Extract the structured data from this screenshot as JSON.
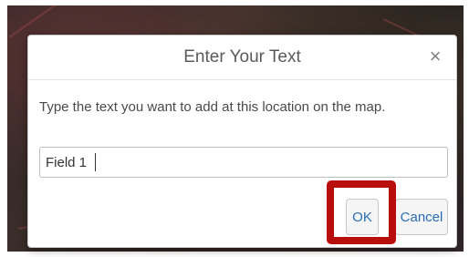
{
  "dialog": {
    "title": "Enter Your Text",
    "close_icon": "close-icon",
    "close_glyph": "×",
    "message": "Type the text you want to add at this location on the map.",
    "input_value": "Field 1",
    "ok_label": "OK",
    "cancel_label": "Cancel"
  },
  "annotation": {
    "highlight_color": "#b90e0e",
    "highlight_target": "ok-button"
  },
  "colors": {
    "button_text": "#2a6db5",
    "title_text": "#5a5a5a"
  }
}
